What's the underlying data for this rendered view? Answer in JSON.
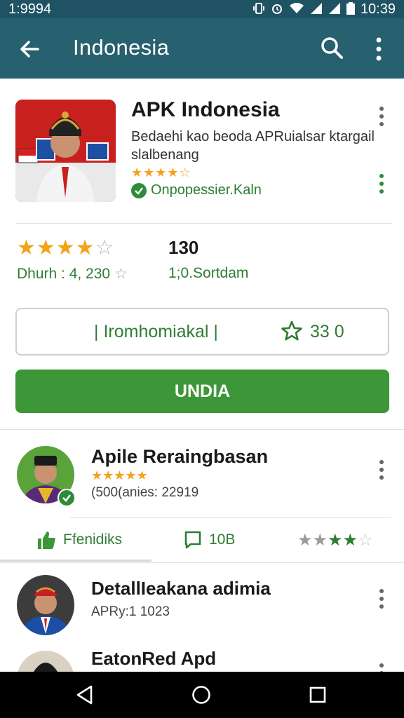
{
  "status_bar": {
    "time_left": "1:9994",
    "time_right": "10:39",
    "icons": [
      "vibrate-icon",
      "alarm-icon",
      "wifi-icon",
      "signal-icon",
      "signal-icon",
      "battery-icon"
    ]
  },
  "app_bar": {
    "title": "Indonesia",
    "icons": [
      "back-arrow-icon",
      "search-icon",
      "more-vert-icon"
    ]
  },
  "app": {
    "title": "APK Indonesia",
    "description": "Bedaehi kao beoda APRuialsar ktargail slalbenang",
    "small_stars": "★★★★☆",
    "verified_label": "Onpopessier.Kaln"
  },
  "rating": {
    "stars_filled": "★★★★",
    "stars_empty": "☆",
    "count": "130",
    "sub_label": "Dhurh : 4, 230",
    "sub_star": "☆",
    "sub_label_2": "1;0.Sortdam"
  },
  "wishlist_button": {
    "label": "| Iromhomiakal |",
    "count": "33 0"
  },
  "install_button": {
    "label": "UNDIA"
  },
  "review": {
    "name": "Apile Reraingbasan",
    "stars": "★★★★★",
    "meta": "(500(anies: 22919"
  },
  "actions": {
    "like_label": "Ffenidiks",
    "comment_label": "10B",
    "stars_gray": "★★",
    "stars_green": "★★",
    "stars_empty": "☆"
  },
  "list": [
    {
      "name": "DetallIeakana adimia",
      "meta": "APRy:1 1023"
    },
    {
      "name": "EatonRed Apd",
      "meta": ""
    }
  ],
  "colors": {
    "status_bar": "#1f5363",
    "app_bar": "#27606f",
    "primary_green": "#3d9637",
    "text_green": "#2e7d32",
    "star_gold": "#f3a21a"
  }
}
